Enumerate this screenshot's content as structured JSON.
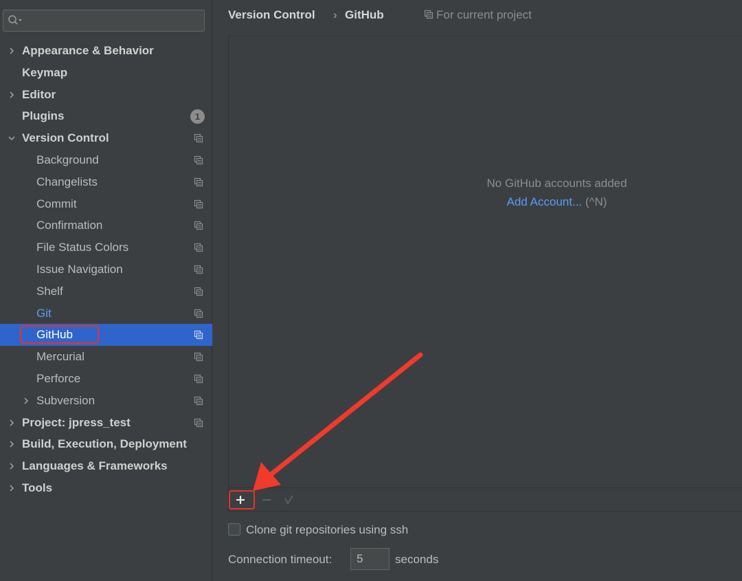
{
  "search": {
    "placeholder": "",
    "value": ""
  },
  "sidebar": {
    "items": [
      {
        "label": "Appearance & Behavior",
        "level": "top",
        "chevron": "right"
      },
      {
        "label": "Keymap",
        "level": "top",
        "chevron": "none"
      },
      {
        "label": "Editor",
        "level": "top",
        "chevron": "right"
      },
      {
        "label": "Plugins",
        "level": "top",
        "chevron": "none",
        "badge": "1"
      },
      {
        "label": "Version Control",
        "level": "top",
        "chevron": "down",
        "project_icon": true
      },
      {
        "label": "Background",
        "level": "child",
        "project_icon": true
      },
      {
        "label": "Changelists",
        "level": "child",
        "project_icon": true
      },
      {
        "label": "Commit",
        "level": "child",
        "project_icon": true
      },
      {
        "label": "Confirmation",
        "level": "child",
        "project_icon": true
      },
      {
        "label": "File Status Colors",
        "level": "child",
        "project_icon": true
      },
      {
        "label": "Issue Navigation",
        "level": "child",
        "project_icon": true
      },
      {
        "label": "Shelf",
        "level": "child",
        "project_icon": true
      },
      {
        "label": "Git",
        "level": "child",
        "project_icon": true,
        "highlight": "link"
      },
      {
        "label": "GitHub",
        "level": "child",
        "project_icon": true,
        "selected": true
      },
      {
        "label": "Mercurial",
        "level": "child",
        "project_icon": true
      },
      {
        "label": "Perforce",
        "level": "child",
        "project_icon": true
      },
      {
        "label": "Subversion",
        "level": "child",
        "chevron": "right",
        "project_icon": true
      },
      {
        "label": "Project: jpress_test",
        "level": "top",
        "chevron": "right",
        "project_icon": true
      },
      {
        "label": "Build, Execution, Deployment",
        "level": "top",
        "chevron": "right"
      },
      {
        "label": "Languages & Frameworks",
        "level": "top",
        "chevron": "right"
      },
      {
        "label": "Tools",
        "level": "top",
        "chevron": "right"
      }
    ]
  },
  "breadcrumb": {
    "parent": "Version Control",
    "separator": "›",
    "current": "GitHub"
  },
  "scope_label": "For current project",
  "accounts": {
    "empty_text": "No GitHub accounts added",
    "add_link": "Add Account...",
    "add_shortcut": "(^N)"
  },
  "toolbar": {
    "add": "+",
    "remove": "−",
    "apply": "✓"
  },
  "options": {
    "clone_ssh_label": "Clone git repositories using ssh",
    "clone_ssh_checked": false,
    "timeout_label": "Connection timeout:",
    "timeout_value": "5",
    "timeout_unit": "seconds"
  },
  "colors": {
    "background": "#3c3f41",
    "selection": "#2f65ca",
    "link": "#589df6",
    "annotation": "#e8322b"
  }
}
